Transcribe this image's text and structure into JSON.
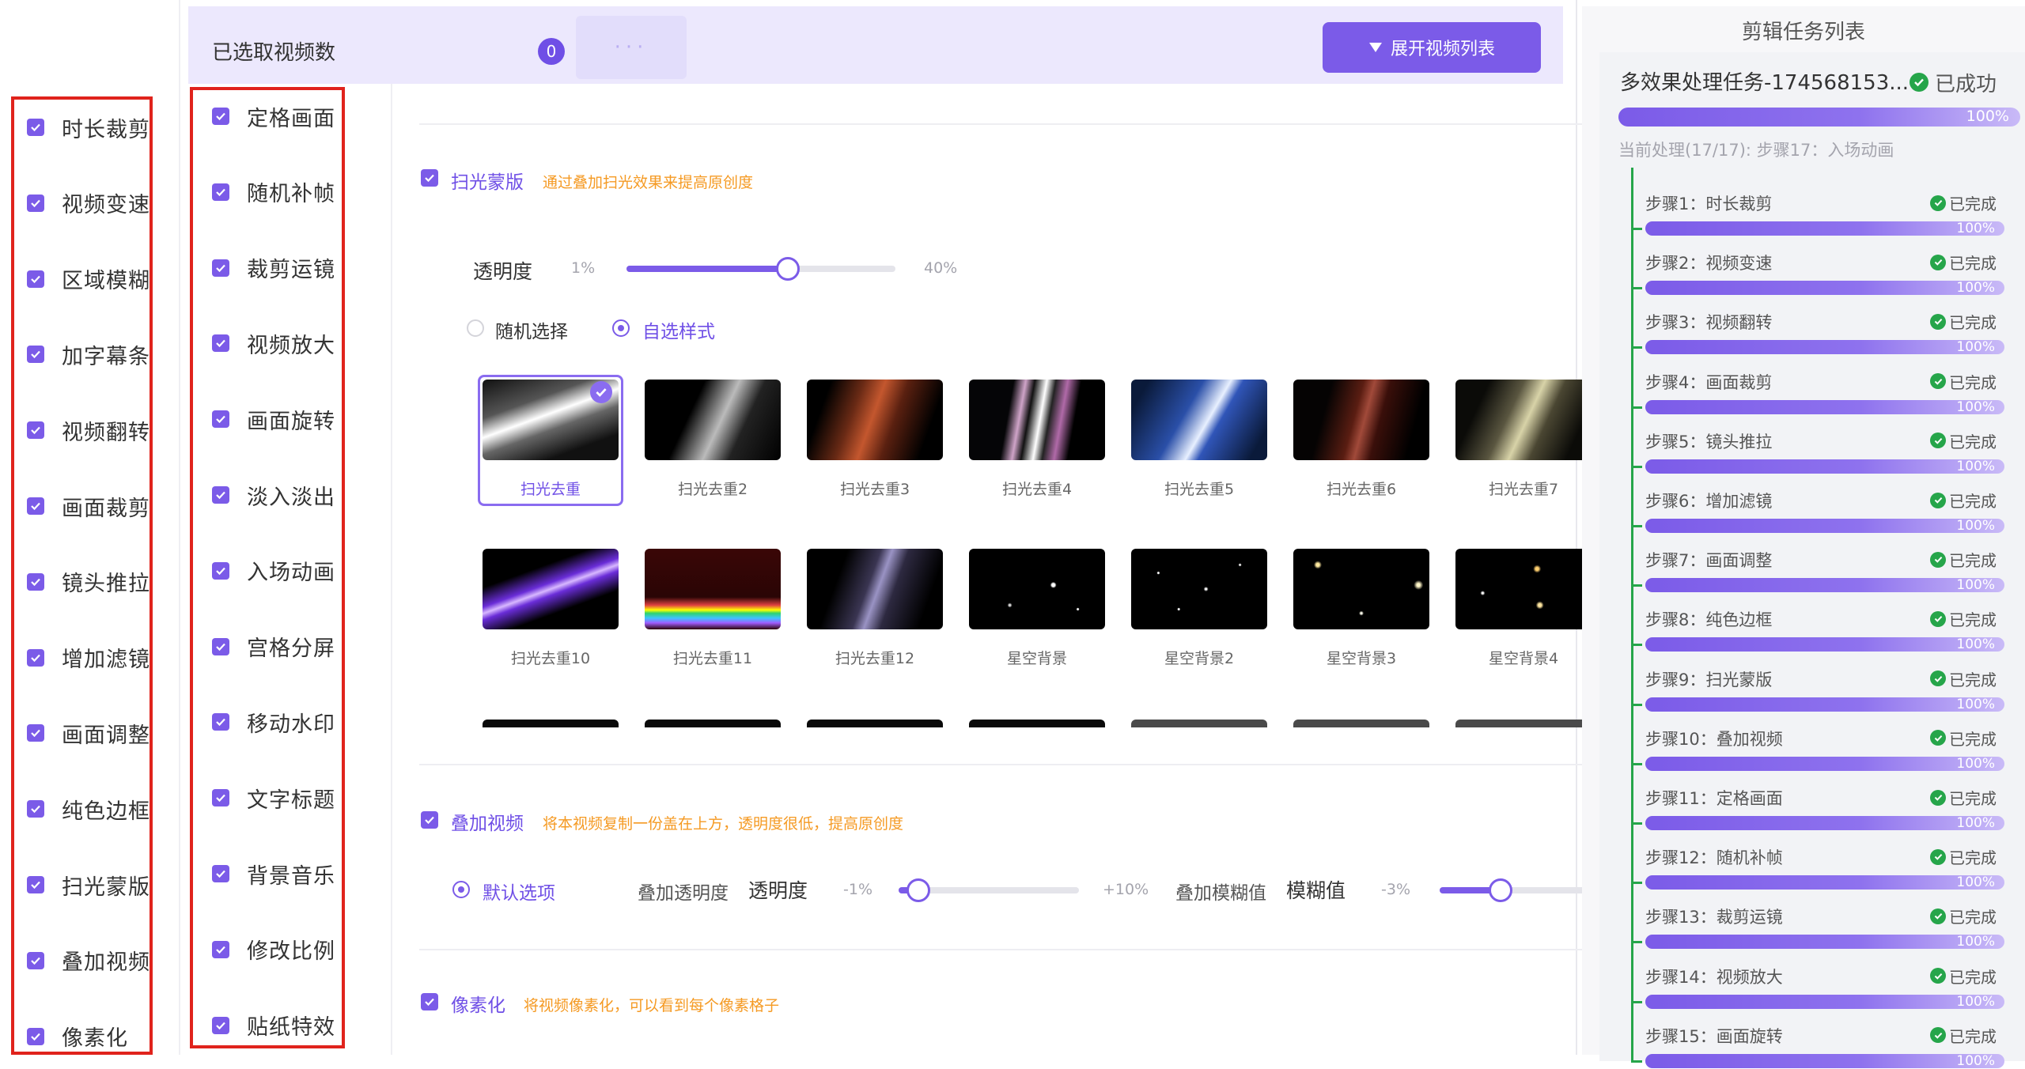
{
  "left_col1": {
    "items": [
      "时长裁剪",
      "视频变速",
      "区域模糊",
      "加字幕条",
      "视频翻转",
      "画面裁剪",
      "镜头推拉",
      "增加滤镜",
      "画面调整",
      "纯色边框",
      "扫光蒙版",
      "叠加视频",
      "像素化"
    ]
  },
  "left_col2": {
    "items": [
      "定格画面",
      "随机补帧",
      "裁剪运镜",
      "视频放大",
      "画面旋转",
      "淡入淡出",
      "入场动画",
      "宫格分屏",
      "移动水印",
      "文字标题",
      "背景音乐",
      "修改比例",
      "贴纸特效"
    ]
  },
  "topbar": {
    "title": "已选取视频数",
    "count": "0",
    "dots": "···",
    "expand_label": "展开视频列表"
  },
  "sweep": {
    "title": "扫光蒙版",
    "desc": "通过叠加扫光效果来提高原创度",
    "opacity_label": "透明度",
    "opacity_min": "1%",
    "opacity_max": "40%",
    "opacity_value_fraction": 0.6,
    "radio_random": "随机选择",
    "radio_custom": "自选样式",
    "thumbs_row1": [
      "扫光去重",
      "扫光去重2",
      "扫光去重3",
      "扫光去重4",
      "扫光去重5",
      "扫光去重6",
      "扫光去重7"
    ],
    "thumbs_row2": [
      "扫光去重10",
      "扫光去重11",
      "扫光去重12",
      "星空背景",
      "星空背景2",
      "星空背景3",
      "星空背景4"
    ]
  },
  "overlay": {
    "title": "叠加视频",
    "desc": "将本视频复制一份盖在上方，透明度很低，提高原创度",
    "radio_default": "默认选项",
    "opacity_caption": "叠加透明度",
    "opacity_label": "透明度",
    "opacity_min": "-1%",
    "opacity_max": "+10%",
    "blur_caption": "叠加模糊值",
    "blur_label": "模糊值",
    "blur_min": "-3%"
  },
  "pixelate": {
    "title": "像素化",
    "desc": "将视频像素化，可以看到每个像素格子"
  },
  "task_panel": {
    "title": "剪辑任务列表",
    "task_name": "多效果处理任务-174568153...",
    "status": "已成功",
    "progress": "100%",
    "current": "当前处理(17/17): 步骤17：入场动画",
    "steps": [
      {
        "label": "步骤1：时长裁剪",
        "status": "已完成",
        "progress": "100%"
      },
      {
        "label": "步骤2：视频变速",
        "status": "已完成",
        "progress": "100%"
      },
      {
        "label": "步骤3：视频翻转",
        "status": "已完成",
        "progress": "100%"
      },
      {
        "label": "步骤4：画面裁剪",
        "status": "已完成",
        "progress": "100%"
      },
      {
        "label": "步骤5：镜头推拉",
        "status": "已完成",
        "progress": "100%"
      },
      {
        "label": "步骤6：增加滤镜",
        "status": "已完成",
        "progress": "100%"
      },
      {
        "label": "步骤7：画面调整",
        "status": "已完成",
        "progress": "100%"
      },
      {
        "label": "步骤8：纯色边框",
        "status": "已完成",
        "progress": "100%"
      },
      {
        "label": "步骤9：扫光蒙版",
        "status": "已完成",
        "progress": "100%"
      },
      {
        "label": "步骤10：叠加视频",
        "status": "已完成",
        "progress": "100%"
      },
      {
        "label": "步骤11：定格画面",
        "status": "已完成",
        "progress": "100%"
      },
      {
        "label": "步骤12：随机补帧",
        "status": "已完成",
        "progress": "100%"
      },
      {
        "label": "步骤13：裁剪运镜",
        "status": "已完成",
        "progress": "100%"
      },
      {
        "label": "步骤14：视频放大",
        "status": "已完成",
        "progress": "100%"
      },
      {
        "label": "步骤15：画面旋转",
        "status": "已完成",
        "progress": "100%"
      }
    ]
  },
  "colors": {
    "accent": "#7b5be8",
    "success": "#26a54a",
    "warning_text": "#f59a23",
    "highlight_border": "#e0231c"
  }
}
